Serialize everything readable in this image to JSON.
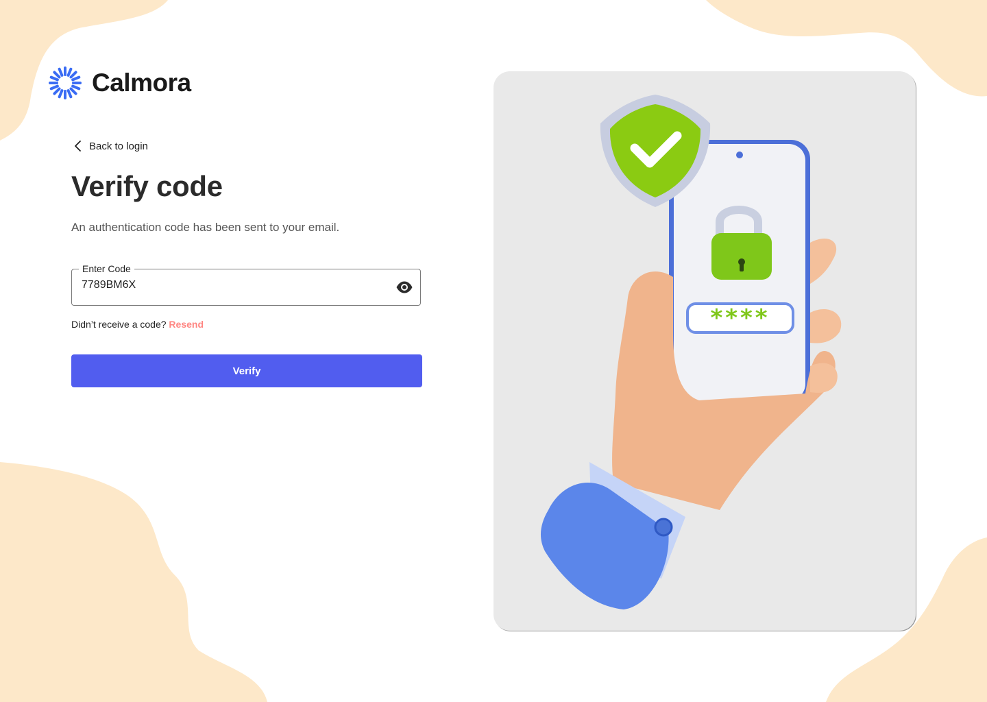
{
  "brand": {
    "name": "Calmora",
    "accent_color": "#3a6cf4"
  },
  "back_link": {
    "icon": "chevron-left-icon",
    "label": "Back to login"
  },
  "page": {
    "title": "Verify code",
    "subtitle": "An authentication code has been sent to your email."
  },
  "code_field": {
    "label": "Enter Code",
    "value": "7789BM6X",
    "toggle_icon": "eye-icon"
  },
  "resend": {
    "prompt": "Didn’t receive a code?",
    "link_label": "Resend",
    "link_color": "#ff8682"
  },
  "verify_button": {
    "label": "Verify",
    "color": "#515def"
  },
  "hero_illustration": {
    "subject": "hand holding phone with padlock, shield checkmark and masked code",
    "code_mask": "****"
  },
  "background": {
    "blob_color": "#fde8c9"
  }
}
